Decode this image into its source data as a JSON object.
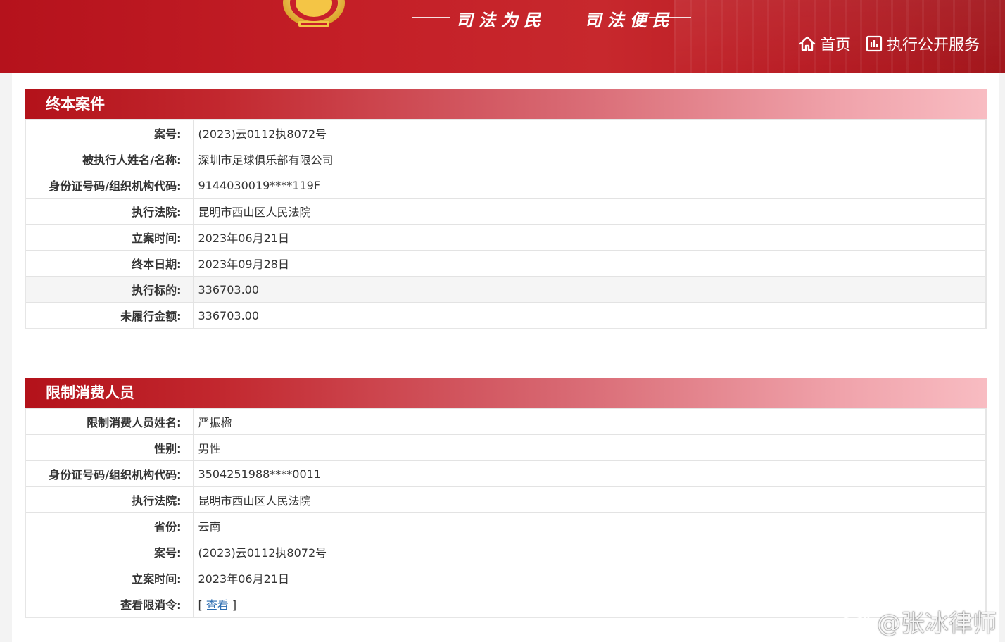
{
  "header": {
    "slogan_left": "司法为民",
    "slogan_right": "司法便民",
    "nav": [
      {
        "label": "首页",
        "icon": "home-icon"
      },
      {
        "label": "执行公开服务",
        "icon": "chart-icon"
      }
    ]
  },
  "sections": [
    {
      "title": "终本案件",
      "rows": [
        {
          "label": "案号:",
          "value": "(2023)云0112执8072号"
        },
        {
          "label": "被执行人姓名/名称:",
          "value": "深圳市足球俱乐部有限公司"
        },
        {
          "label": "身份证号码/组织机构代码:",
          "value": "9144030019****119F"
        },
        {
          "label": "执行法院:",
          "value": "昆明市西山区人民法院"
        },
        {
          "label": "立案时间:",
          "value": "2023年06月21日"
        },
        {
          "label": "终本日期:",
          "value": "2023年09月28日"
        },
        {
          "label": "执行标的:",
          "value": "336703.00"
        },
        {
          "label": "未履行金额:",
          "value": "336703.00"
        }
      ]
    },
    {
      "title": "限制消费人员",
      "rows": [
        {
          "label": "限制消费人员姓名:",
          "value": "严振楹"
        },
        {
          "label": "性别:",
          "value": "男性"
        },
        {
          "label": "身份证号码/组织机构代码:",
          "value": "3504251988****0011"
        },
        {
          "label": "执行法院:",
          "value": "昆明市西山区人民法院"
        },
        {
          "label": "省份:",
          "value": "云南"
        },
        {
          "label": "案号:",
          "value": "(2023)云0112执8072号"
        },
        {
          "label": "立案时间:",
          "value": "2023年06月21日"
        },
        {
          "label": "查看限消令:",
          "link_open": "[ ",
          "link_text": "查看",
          "link_close": " ]"
        }
      ]
    }
  ],
  "watermark": {
    "text": "@张冰律师",
    "icon": "weibo-icon"
  },
  "colors": {
    "banner": "#c41f27",
    "title_start": "#b3121a",
    "title_end": "#f8bcc2",
    "link": "#2b6cb0"
  }
}
